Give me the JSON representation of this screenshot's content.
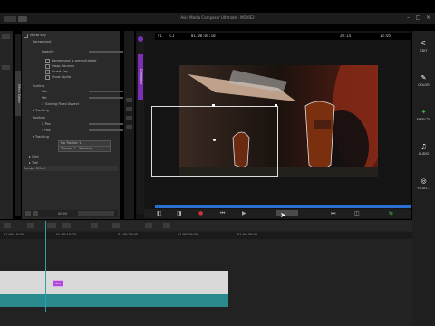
{
  "app": {
    "title": "Avid Media Composer Ultimate - MOVIE2",
    "min": "–",
    "max": "□",
    "close": "×"
  },
  "effect_editor": {
    "tab_label": "Effect Editor",
    "effect_name": "Matte Key",
    "section_foreground": "Foreground",
    "opacity_label": "Opacity",
    "opacity_value": "100",
    "options": [
      "Foreground is premultiplied",
      "Swap Sources",
      "Invert Key",
      "Show Alpha"
    ],
    "section_scaling": "Scaling",
    "width_label": "Hor",
    "width_value": "62",
    "height_label": "Ver",
    "height_value": "62",
    "fixed_aspect": "Scaling Fixed Aspect",
    "section_position": "Position",
    "x_label": "X Pos",
    "x_value": "-333",
    "y_label": "Y Pos",
    "y_value": "64",
    "section_tracking": "Tracking",
    "tracker_select": "No Tracker 1",
    "tracker_select2": "Tracker 1 - Tracking",
    "section_grid": "Grid",
    "section_trail": "Trail",
    "render_button": "Render Effect",
    "bottom_time": "00:00"
  },
  "composer": {
    "side_tab": "Composer",
    "track_label": "V1",
    "tc_label": "TC1",
    "tc_center": "01:00:04:10",
    "tc_right1": "20:14",
    "tc_right2": "13:05"
  },
  "right_bar": {
    "items": [
      {
        "label": "EDIT",
        "icon": "⚟"
      },
      {
        "label": "COLOR",
        "icon": "✎"
      },
      {
        "label": "EFFECTS",
        "icon": "✦"
      },
      {
        "label": "AUDIO",
        "icon": "♫"
      },
      {
        "label": "FLOAT...",
        "icon": "◎"
      }
    ]
  },
  "timeline": {
    "ticks": [
      "01:00:10:00",
      "01:00:15:00",
      "01:00:20:00",
      "01:00:25:00",
      "01:00:30:00"
    ],
    "clip_marker": "Grn"
  },
  "colors": {
    "accent_blue": "#2b6fd1",
    "accent_green": "#3fae49",
    "accent_purple": "#b04ad8",
    "playhead": "#2aa1b3"
  }
}
